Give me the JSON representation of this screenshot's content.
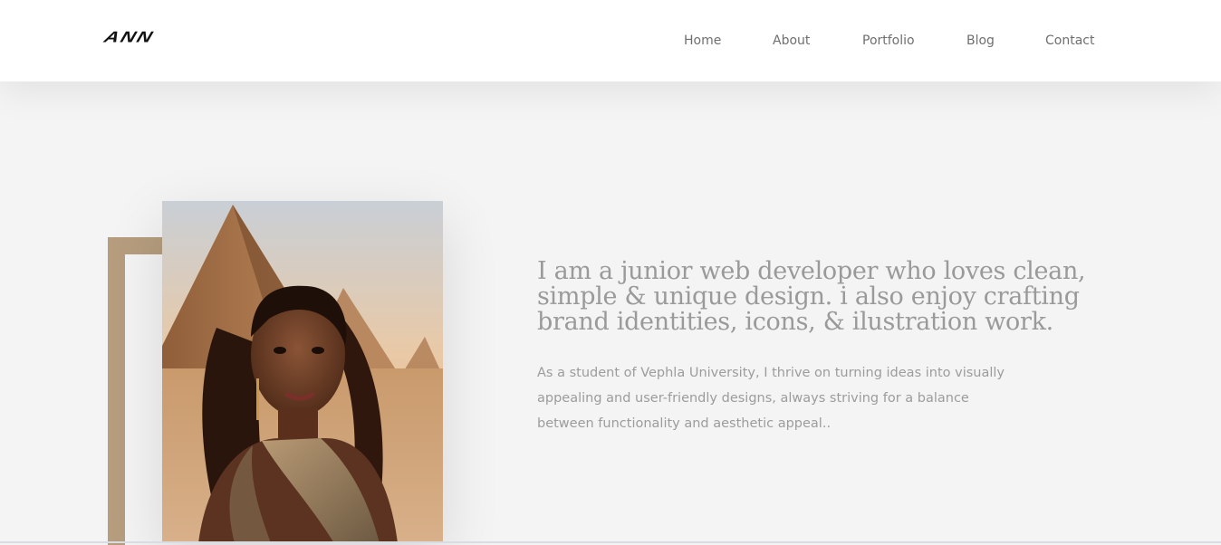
{
  "header": {
    "logo_text": "ANN",
    "nav": [
      {
        "label": "Home"
      },
      {
        "label": "About"
      },
      {
        "label": "Portfolio"
      },
      {
        "label": "Blog"
      },
      {
        "label": "Contact"
      }
    ]
  },
  "hero": {
    "headline": "I am a junior web developer who loves clean, simple & unique design. i also enjoy crafting brand identities, icons, & ilustration work.",
    "bio": "As a student of Vephla University, I thrive on turning ideas into visually appealing and user-friendly designs, always striving for a balance between functionality and aesthetic appeal..",
    "portrait_icon": "portrait-photo"
  },
  "colors": {
    "accent": "#b69d7e",
    "text_muted": "#9a9a9a",
    "nav_text": "#6f6f6f",
    "background": "#f4f4f4"
  }
}
